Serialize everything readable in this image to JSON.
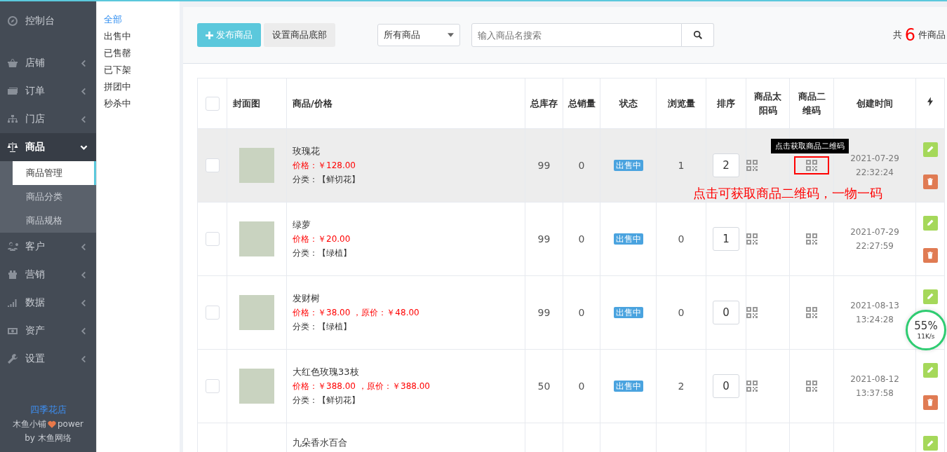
{
  "sidebar": {
    "items": [
      {
        "kind": "link",
        "label": "控制台",
        "selected": false
      },
      {
        "kind": "group",
        "label": "店铺",
        "selected": false,
        "expanded": false
      },
      {
        "kind": "group",
        "label": "订单",
        "selected": false,
        "expanded": false
      },
      {
        "kind": "group",
        "label": "门店",
        "selected": false,
        "expanded": false
      },
      {
        "kind": "group",
        "label": "商品",
        "selected": true,
        "expanded": true,
        "children": [
          {
            "label": "商品管理",
            "selected": true
          },
          {
            "label": "商品分类",
            "selected": false
          },
          {
            "label": "商品规格",
            "selected": false
          }
        ]
      },
      {
        "kind": "group",
        "label": "客户",
        "selected": false,
        "expanded": false
      },
      {
        "kind": "group",
        "label": "营销",
        "selected": false,
        "expanded": false
      },
      {
        "kind": "group",
        "label": "数据",
        "selected": false,
        "expanded": false
      },
      {
        "kind": "group",
        "label": "资产",
        "selected": false,
        "expanded": false
      },
      {
        "kind": "group",
        "label": "设置",
        "selected": false,
        "expanded": false
      }
    ],
    "footer": {
      "shop": "四季花店",
      "brand": "木鱼小铺",
      "power": "power",
      "by": "by 木鱼网络"
    }
  },
  "filters": [
    {
      "label": "全部",
      "selected": true
    },
    {
      "label": "出售中",
      "selected": false
    },
    {
      "label": "已售罄",
      "selected": false
    },
    {
      "label": "已下架",
      "selected": false
    },
    {
      "label": "拼团中",
      "selected": false
    },
    {
      "label": "秒杀中",
      "selected": false
    }
  ],
  "toolbar": {
    "publish": "发布商品",
    "bottom_settings": "设置商品底部",
    "select": "所有商品",
    "search": {
      "placeholder": "输入商品名搜索"
    },
    "count_prefix": "共",
    "count": "6",
    "count_suffix": "件商品"
  },
  "table": {
    "all_checked": false,
    "columns": [
      "封面图",
      "商品/价格",
      "总库存",
      "总销量",
      "状态",
      "浏览量",
      "排序",
      "商品太阳码",
      "商品二维码",
      "创建时间"
    ],
    "rows": [
      {
        "selected": true,
        "checked": false,
        "name": "玫瑰花",
        "price": "价格：￥128.00",
        "category": "分类：【鲜切花】",
        "stock": "99",
        "sales": "0",
        "status": "出售中",
        "views": "1",
        "sort": "2",
        "qr_highlighted": true,
        "created": "2021-07-29 22:32:24"
      },
      {
        "selected": false,
        "checked": false,
        "name": "绿萝",
        "price": "价格：￥20.00",
        "category": "分类：【绿植】",
        "stock": "99",
        "sales": "0",
        "status": "出售中",
        "views": "0",
        "sort": "1",
        "qr_highlighted": false,
        "created": "2021-07-29 22:27:59"
      },
      {
        "selected": false,
        "checked": false,
        "name": "发财树",
        "price": "价格：￥38.00",
        "original": "，原价：￥48.00",
        "category": "分类：【绿植】",
        "stock": "99",
        "sales": "0",
        "status": "出售中",
        "views": "0",
        "sort": "0",
        "qr_highlighted": false,
        "created": "2021-08-13 13:24:28"
      },
      {
        "selected": false,
        "checked": false,
        "name": "大红色玫瑰33枝",
        "price": "价格：￥388.00",
        "original": "，原价：￥388.00",
        "category": "分类：【鲜切花】",
        "stock": "50",
        "sales": "0",
        "status": "出售中",
        "views": "2",
        "sort": "0",
        "qr_highlighted": false,
        "created": "2021-08-12 13:37:58"
      },
      {
        "selected": false,
        "name": "九朵香水百合"
      }
    ]
  },
  "tooltip": "点击获取商品二维码",
  "annotation": "点击可获取商品二维码，一物一码",
  "speed_widget": {
    "percent": "55%",
    "speed": "11K/s"
  }
}
